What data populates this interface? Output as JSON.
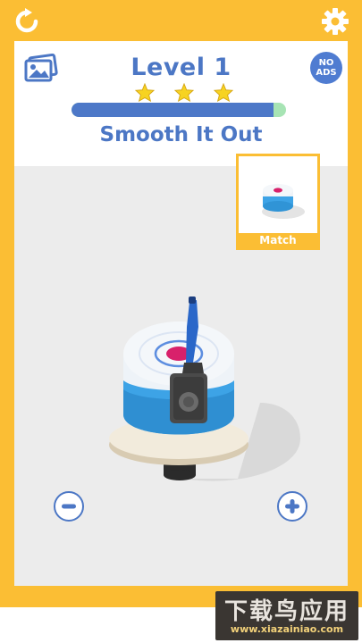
{
  "header": {
    "restart_icon": "restart-icon",
    "settings_icon": "gear-icon",
    "gallery_icon": "gallery-icon",
    "level_title": "Level 1",
    "stars_earned": 3,
    "stars_total": 3,
    "progress": 0.94,
    "subtitle": "Smooth It Out",
    "no_ads_line1": "NO",
    "no_ads_line2": "ADS"
  },
  "match_card": {
    "label": "Match"
  },
  "controls": {
    "zoom_out_icon": "minus-icon",
    "zoom_in_icon": "plus-icon"
  },
  "watermark": {
    "main": "下载鸟应用",
    "url": "www.xiazainiao.com"
  },
  "colors": {
    "frame": "#fbbe34",
    "accent_blue": "#4c77c5",
    "progress_green": "#a7e4b4",
    "star": "#f7d321",
    "cake_blue": "#3da3e6",
    "frosting_center": "#d8216b"
  }
}
